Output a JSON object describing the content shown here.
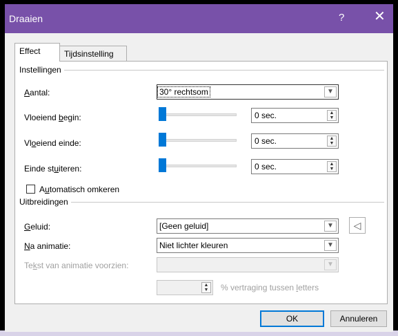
{
  "window": {
    "title": "Draaien",
    "help_label": "?",
    "close_label": "✕",
    "title_color": "#7851a9"
  },
  "tabs": [
    {
      "label": "Effect",
      "active": true
    },
    {
      "label": "Tijdsinstelling",
      "active": false
    }
  ],
  "instellingen": {
    "header": "Instellingen",
    "aantal": {
      "label_pre": "",
      "label_key": "A",
      "label_post": "antal:",
      "value": "30° rechtsom"
    },
    "vloeiend_begin": {
      "label_pre": "Vloeiend ",
      "label_key": "b",
      "label_post": "egin:",
      "value": "0 sec.",
      "slider_value": 0
    },
    "vloeiend_einde": {
      "label_pre": "Vl",
      "label_key": "o",
      "label_post": "eiend einde:",
      "value": "0 sec.",
      "slider_value": 0
    },
    "einde_stuiteren": {
      "label_pre": "Einde st",
      "label_key": "u",
      "label_post": "iteren:",
      "value": "0 sec.",
      "slider_value": 0
    },
    "auto_omkeren": {
      "label_pre": "A",
      "label_key": "u",
      "label_post": "tomatisch omkeren",
      "checked": false
    }
  },
  "uitbreidingen": {
    "header": "Uitbreidingen",
    "geluid": {
      "label_pre": "",
      "label_key": "G",
      "label_post": "eluid:",
      "value": "[Geen geluid]"
    },
    "na_animatie": {
      "label_pre": "",
      "label_key": "N",
      "label_post": "a animatie:",
      "value": "Niet lichter kleuren"
    },
    "tekst_animatie": {
      "label_pre": "Te",
      "label_key": "k",
      "label_post": "st van animatie voorzien:",
      "value": ""
    },
    "vertraging": {
      "value": "",
      "label_pre": "% vertraging tussen ",
      "label_key": "l",
      "label_post": "etters"
    }
  },
  "buttons": {
    "ok": "OK",
    "cancel": "Annuleren"
  },
  "icons": {
    "combo_arrow": "chevron-down-icon",
    "spin": "spin-arrows-icon",
    "sound": "speaker-icon"
  }
}
